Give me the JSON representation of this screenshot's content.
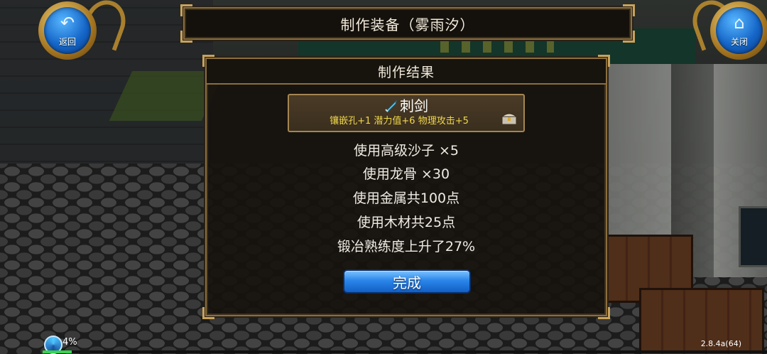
{
  "top_buttons": {
    "back": {
      "label": "返回",
      "icon": "back-arrow-icon"
    },
    "close": {
      "label": "关闭",
      "icon": "home-icon"
    }
  },
  "banner": {
    "title": "制作装备（雾雨汐）"
  },
  "result_panel": {
    "title": "制作结果",
    "item": {
      "name": "刺剑",
      "icon": "sword-icon",
      "stats": "镶嵌孔+1  潜力值+6  物理攻击+5",
      "badge_icon": "treasure-chest-icon"
    },
    "lines": [
      "使用高级沙子  ×5",
      "使用龙骨  ×30",
      "使用金属共100点",
      "使用木材共25点",
      "锻冶熟练度上升了27%"
    ],
    "done_label": "完成"
  },
  "status": {
    "loading_percent_text": "4%",
    "loading_progress": 0.04,
    "version": "2.8.4a(64)"
  },
  "colors": {
    "panel_border": "#8a6e3e",
    "stat_text": "#f1d84a",
    "button_blue": "#2b86ea",
    "progress_green": "#3ad14f"
  }
}
